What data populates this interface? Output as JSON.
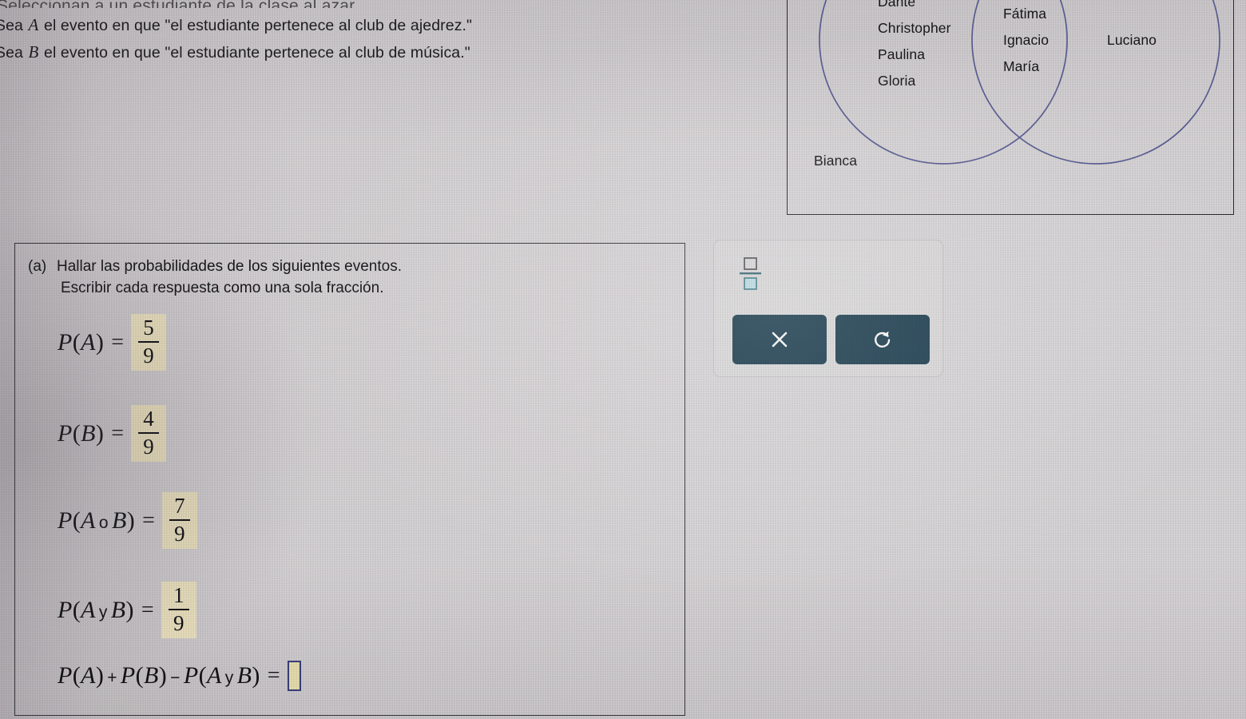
{
  "problem": {
    "intro_cut": "Seleccionan a un estudiante de la clase al azar.",
    "line_a_pre": "Sea",
    "line_a_var": "A",
    "line_a_post": "el evento en que \"el estudiante pertenece al club de ajedrez.\"",
    "line_b_pre": "Sea",
    "line_b_var": "B",
    "line_b_post": "el evento en que \"el estudiante pertenece al club de música.\""
  },
  "venn": {
    "left_only": [
      "Dante",
      "Christopher",
      "Paulina",
      "Gloria"
    ],
    "intersection": [
      "Fátima",
      "Ignacio",
      "María"
    ],
    "right_only": [
      "Luciano"
    ],
    "outside": [
      "Bianca"
    ],
    "circle_stroke": "#5b5f96",
    "rect_stroke": "#2a2a2e"
  },
  "question": {
    "label": "(a)",
    "prompt_line1": "Hallar las probabilidades de los siguientes eventos.",
    "prompt_line2": "Escribir cada respuesta como una sola fracción.",
    "rows": [
      {
        "name": "p-of-a",
        "lhs_p": "P",
        "lhs_open": "(",
        "lhs_arg1": "A",
        "lhs_conn": "",
        "lhs_arg2": "",
        "lhs_close": ")",
        "eq": "=",
        "answer_type": "fraction",
        "numerator": "5",
        "denominator": "9"
      },
      {
        "name": "p-of-b",
        "lhs_p": "P",
        "lhs_open": "(",
        "lhs_arg1": "B",
        "lhs_conn": "",
        "lhs_arg2": "",
        "lhs_close": ")",
        "eq": "=",
        "answer_type": "fraction",
        "numerator": "4",
        "denominator": "9"
      },
      {
        "name": "p-of-a-or-b",
        "lhs_p": "P",
        "lhs_open": "(",
        "lhs_arg1": "A",
        "lhs_conn": "o",
        "lhs_arg2": "B",
        "lhs_close": ")",
        "eq": "=",
        "answer_type": "fraction",
        "numerator": "7",
        "denominator": "9"
      },
      {
        "name": "p-of-a-and-b",
        "lhs_p": "P",
        "lhs_open": "(",
        "lhs_arg1": "A",
        "lhs_conn": "y",
        "lhs_arg2": "B",
        "lhs_close": ")",
        "eq": "=",
        "answer_type": "fraction",
        "numerator": "1",
        "denominator": "9"
      }
    ],
    "sum_row": {
      "name": "inclusion-exclusion",
      "expr_1_p": "P",
      "expr_1_arg": "A",
      "plus": "+",
      "expr_2_p": "P",
      "expr_2_arg": "B",
      "minus": "−",
      "expr_3_p": "P",
      "expr_3_arg1": "A",
      "expr_3_conn": "y",
      "expr_3_arg2": "B",
      "eq": "=",
      "answer_value": ""
    },
    "answer_highlight": "#ece2c0",
    "input_border": "#3a3f7a"
  },
  "toolbar": {
    "fraction_template_label": "□/□",
    "clear_label": "×",
    "undo_label": "↺",
    "button_color": "#1b3d4f",
    "icon_color": "#ffffff",
    "fraction_icon_accent": "#8fc6cf"
  }
}
